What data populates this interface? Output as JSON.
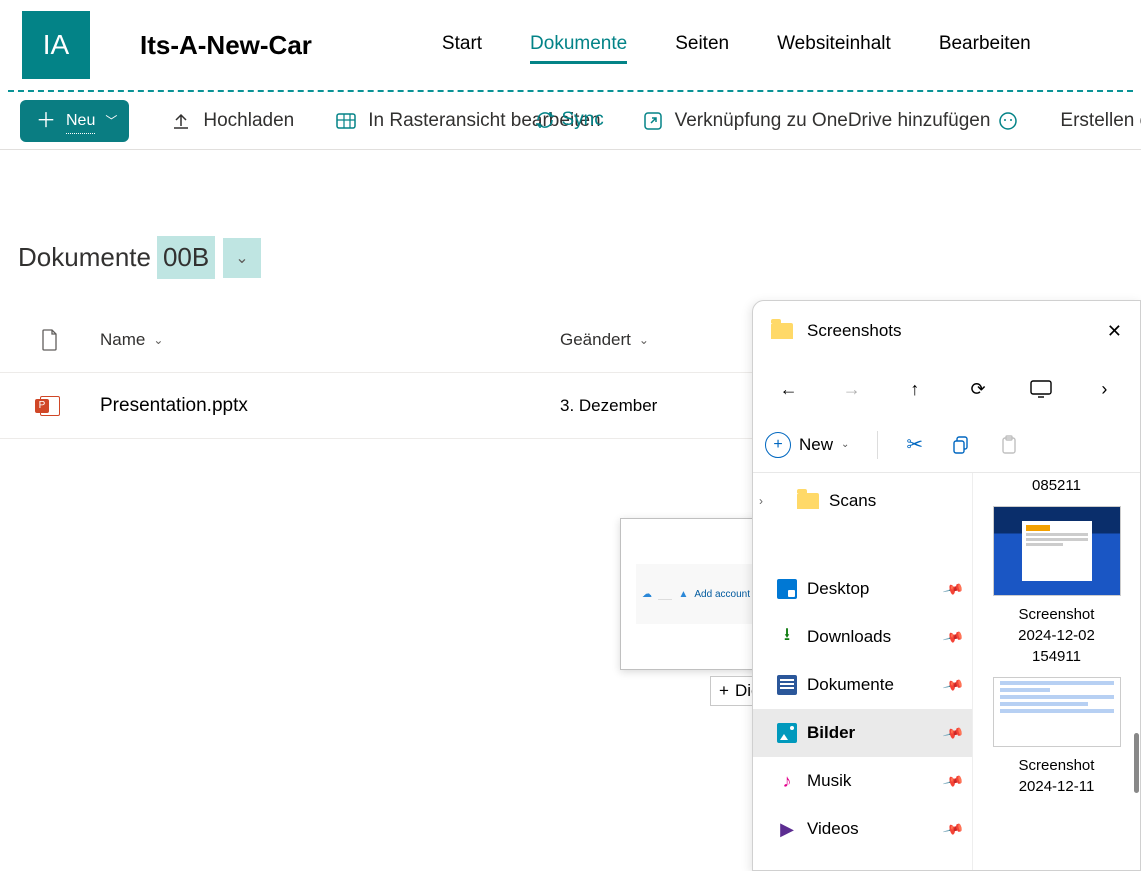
{
  "site": {
    "logo_initials": "IA",
    "title": "Its-A-New-Car",
    "nav": [
      "Start",
      "Dokumente",
      "Seiten",
      "Websiteinhalt",
      "Bearbeiten"
    ],
    "active_nav_index": 1
  },
  "toolbar": {
    "new": "Neu",
    "upload": "Hochladen",
    "grid": "In Rasteransicht bearbeiten",
    "sync": "Sync",
    "shortcut": "Verknüpfung zu OneDrive hinzufügen",
    "create": "Erstellen eines"
  },
  "library": {
    "title_a": "Dokumente ",
    "title_b": "00B",
    "columns": {
      "name": "Name",
      "modified": "Geändert"
    },
    "rows": [
      {
        "name": "Presentation.pptx",
        "modified": "3. Dezember",
        "type": "pptx"
      }
    ]
  },
  "drag": {
    "ghost_text": "Add account",
    "tooltip": "Die Schaltfläche 'Kopieren'"
  },
  "explorer": {
    "title": "Screenshots",
    "cmd_new": "New",
    "truncated_top": "085211",
    "tree": {
      "scans": "Scans",
      "desktop": "Desktop",
      "downloads": "Downloads",
      "documents": "Dokumente",
      "pictures": "Bilder",
      "music": "Musik",
      "videos": "Videos"
    },
    "thumbs": [
      {
        "label_l1": "Screenshot",
        "label_l2": "2024-12-02",
        "label_l3": "154911"
      },
      {
        "label_l1": "Screenshot",
        "label_l2": "2024-12-11"
      }
    ]
  }
}
